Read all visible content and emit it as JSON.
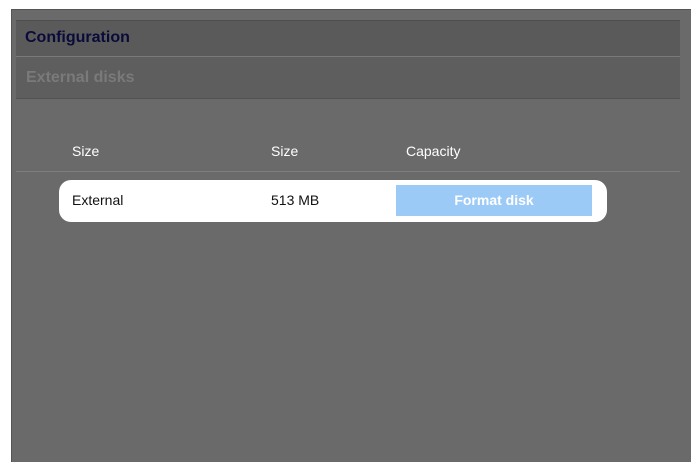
{
  "header": {
    "title": "Configuration"
  },
  "section": {
    "title": "External disks"
  },
  "table": {
    "columns": [
      "Size",
      "Size",
      "Capacity"
    ],
    "rows": [
      {
        "name": "External",
        "size": "513 MB",
        "action_label": "Format disk"
      }
    ]
  },
  "colors": {
    "panel_background": "#6a6a6a",
    "header_background": "#5a5a5a",
    "title_color": "#0b0b3a",
    "button_background": "#9ccaf7"
  }
}
